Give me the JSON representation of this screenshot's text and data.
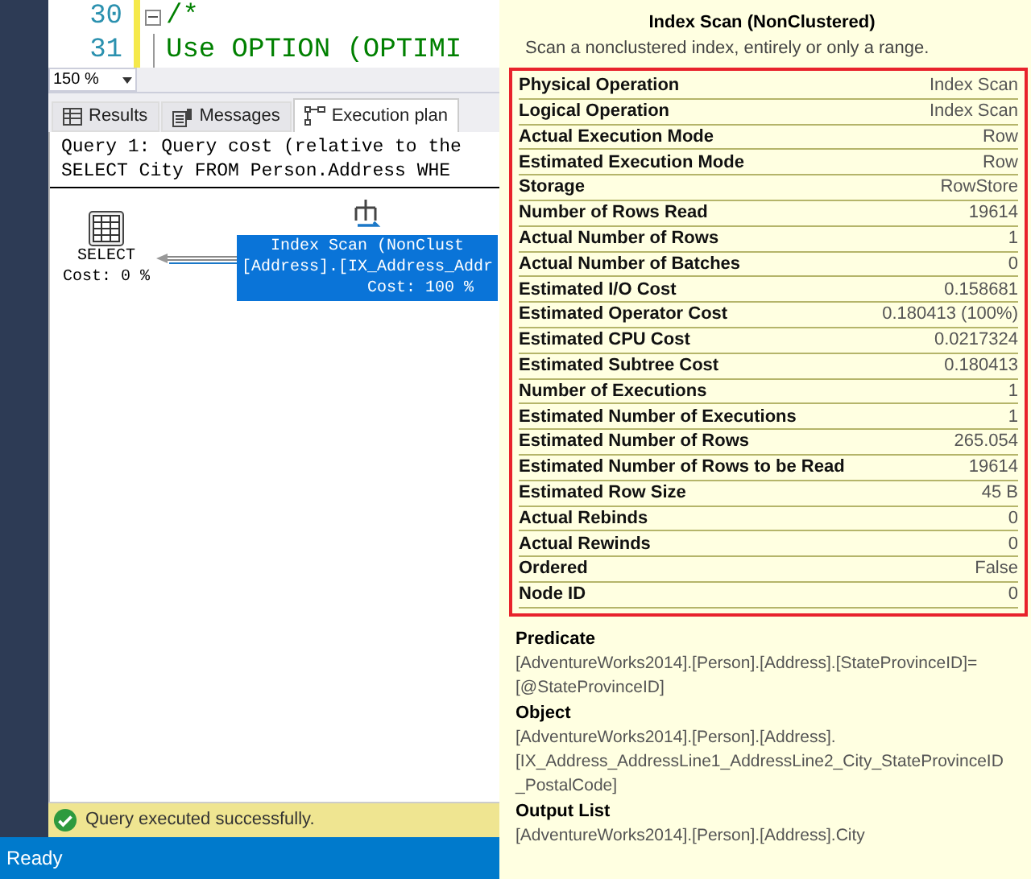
{
  "editor": {
    "lines": [
      {
        "number": "30",
        "text": "/*",
        "collapsible": true
      },
      {
        "number": "31",
        "text": "Use OPTION (OPTIMI",
        "collapsible": false
      }
    ]
  },
  "zoom": {
    "value": "150 %"
  },
  "tabs": [
    {
      "label": "Results",
      "kind": "grid",
      "selected": false
    },
    {
      "label": "Messages",
      "kind": "messages",
      "selected": false
    },
    {
      "label": "Execution plan",
      "kind": "plan",
      "selected": true
    }
  ],
  "plan": {
    "header": [
      "Query 1: Query cost (relative to the",
      "SELECT City FROM Person.Address WHE"
    ],
    "nodes": [
      {
        "kind": "select",
        "label": [
          "SELECT"
        ],
        "cost": "Cost: 0 %",
        "selected": false
      },
      {
        "kind": "index_scan",
        "label": [
          "Index Scan (NonClust",
          "[Address].[IX_Address_Addr"
        ],
        "cost": "Cost: 100 %",
        "selected": true
      }
    ]
  },
  "message": "Query executed successfully.",
  "status_bar": "Ready",
  "tooltip": {
    "title": "Index Scan (NonClustered)",
    "description": "Scan a nonclustered index, entirely or only a range.",
    "properties": [
      {
        "name": "Physical Operation",
        "value": "Index Scan"
      },
      {
        "name": "Logical Operation",
        "value": "Index Scan"
      },
      {
        "name": "Actual Execution Mode",
        "value": "Row"
      },
      {
        "name": "Estimated Execution Mode",
        "value": "Row"
      },
      {
        "name": "Storage",
        "value": "RowStore"
      },
      {
        "name": "Number of Rows Read",
        "value": "19614"
      },
      {
        "name": "Actual Number of Rows",
        "value": "1"
      },
      {
        "name": "Actual Number of Batches",
        "value": "0"
      },
      {
        "name": "Estimated I/O Cost",
        "value": "0.158681"
      },
      {
        "name": "Estimated Operator Cost",
        "value": "0.180413 (100%)"
      },
      {
        "name": "Estimated CPU Cost",
        "value": "0.0217324"
      },
      {
        "name": "Estimated Subtree Cost",
        "value": "0.180413"
      },
      {
        "name": "Number of Executions",
        "value": "1"
      },
      {
        "name": "Estimated Number of Executions",
        "value": "1"
      },
      {
        "name": "Estimated Number of Rows",
        "value": "265.054"
      },
      {
        "name": "Estimated Number of Rows to be Read",
        "value": "19614"
      },
      {
        "name": "Estimated Row Size",
        "value": "45 B"
      },
      {
        "name": "Actual Rebinds",
        "value": "0"
      },
      {
        "name": "Actual Rewinds",
        "value": "0"
      },
      {
        "name": "Ordered",
        "value": "False"
      },
      {
        "name": "Node ID",
        "value": "0"
      }
    ],
    "sections": [
      {
        "heading": "Predicate",
        "lines": [
          "[AdventureWorks2014].[Person].[Address].[StateProvinceID]=",
          "[@StateProvinceID]"
        ]
      },
      {
        "heading": "Object",
        "lines": [
          "[AdventureWorks2014].[Person].[Address].",
          "[IX_Address_AddressLine1_AddressLine2_City_StateProvinceID",
          "_PostalCode]"
        ]
      },
      {
        "heading": "Output List",
        "lines": [
          "[AdventureWorks2014].[Person].[Address].City"
        ]
      }
    ]
  }
}
